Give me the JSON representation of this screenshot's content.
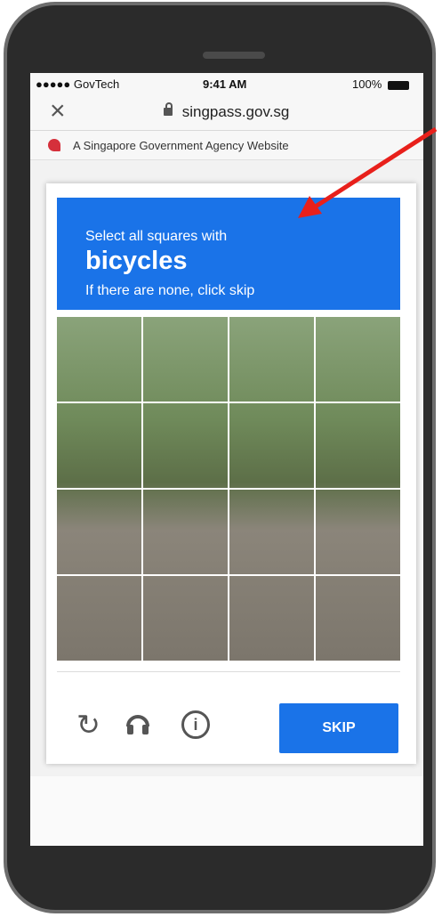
{
  "status_bar": {
    "carrier": "●●●●● GovTech",
    "time": "9:41 AM",
    "battery": "100%"
  },
  "browser": {
    "close_label": "×",
    "url": "singpass.gov.sg"
  },
  "gov_banner": {
    "text": "A Singapore Government Agency Website"
  },
  "captcha": {
    "instruction_line1": "Select all squares with",
    "target_object": "bicycles",
    "instruction_line2": "If there are none, click skip",
    "grid_rows": 4,
    "grid_cols": 4,
    "skip_label": "SKIP",
    "icons": {
      "reload": "reload-icon",
      "audio": "headphones-icon",
      "info": "info-icon"
    }
  },
  "colors": {
    "header_blue": "#1a73e8",
    "arrow_red": "#e8201b",
    "lion_red": "#d5303b"
  }
}
